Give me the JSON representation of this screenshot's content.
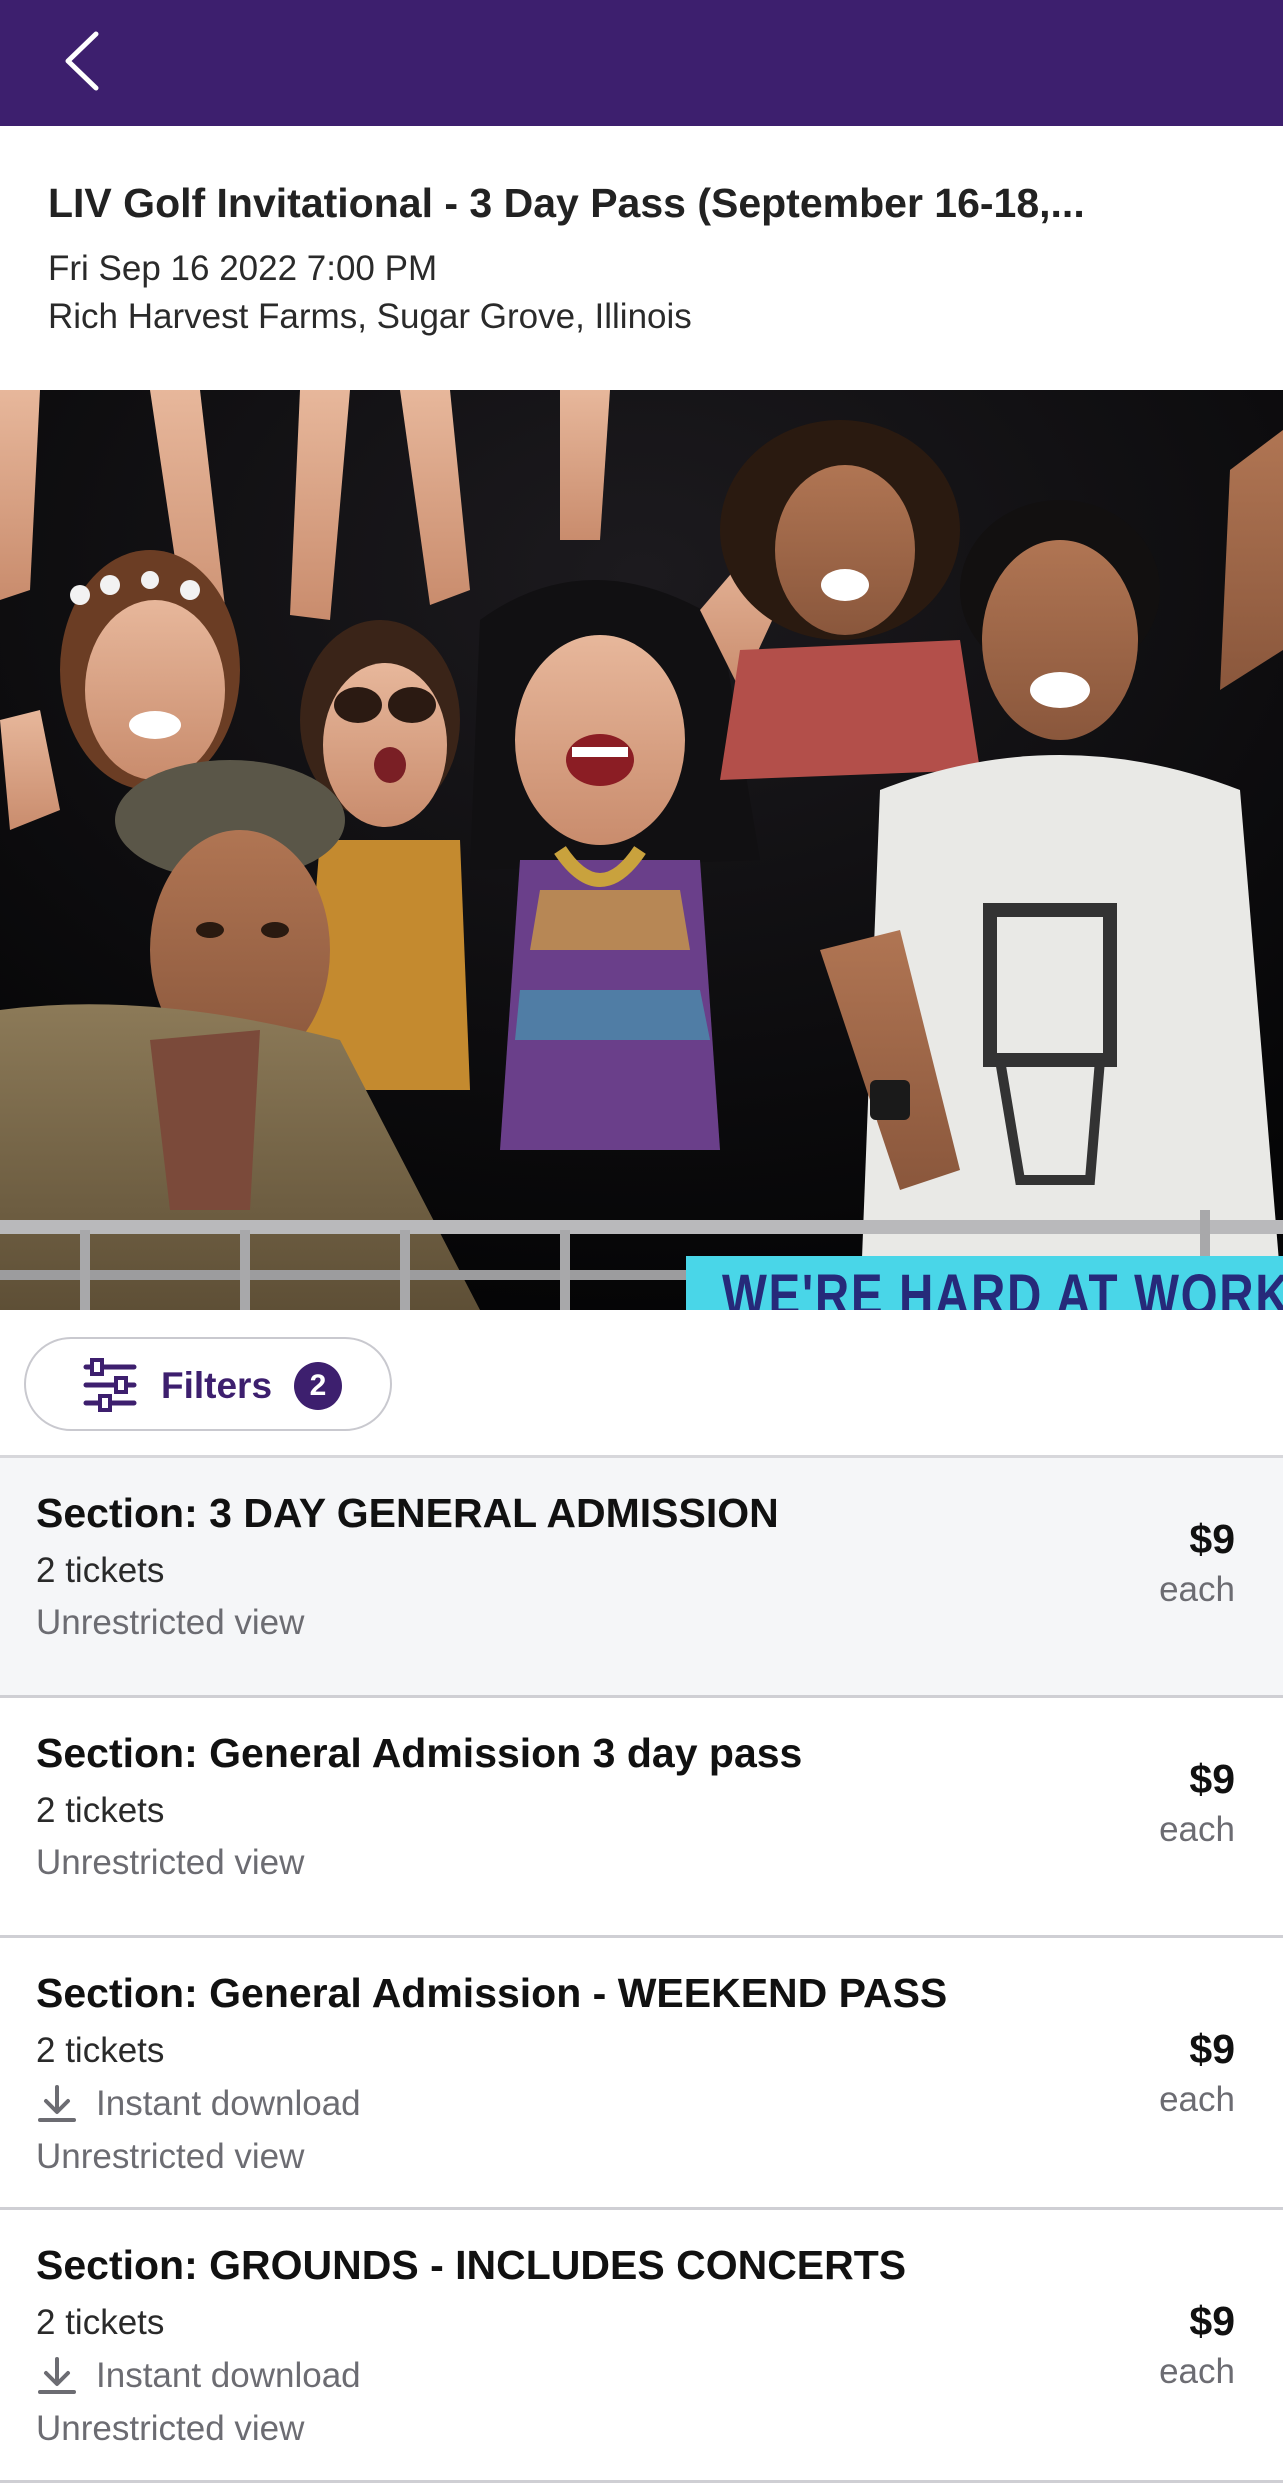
{
  "header": {
    "back_icon": "chevron-left-icon",
    "bar_color": "#3d1f6e"
  },
  "event": {
    "title": "LIV Golf Invitational - 3 Day Pass (September 16-18,...",
    "date": "Fri Sep 16 2022 7:00 PM",
    "venue": "Rich Harvest Farms, Sugar Grove, Illinois"
  },
  "hero": {
    "description_icon": "crowd-photo",
    "banner_text": "WE'RE HARD AT WORK PUTTI"
  },
  "filters": {
    "label": "Filters",
    "count": "2",
    "icon": "sliders-icon"
  },
  "listings": [
    {
      "section": "Section: 3 DAY GENERAL ADMISSION",
      "quantity": "2 tickets",
      "feature": "",
      "view": "Unrestricted view",
      "price": "$9",
      "price_unit": "each"
    },
    {
      "section": "Section: General Admission 3 day pass",
      "quantity": "2 tickets",
      "feature": "",
      "view": "Unrestricted view",
      "price": "$9",
      "price_unit": "each"
    },
    {
      "section": "Section: General Admission - WEEKEND PASS",
      "quantity": "2 tickets",
      "feature": "Instant download",
      "view": "Unrestricted view",
      "price": "$9",
      "price_unit": "each"
    },
    {
      "section": "Section: GROUNDS - INCLUDES CONCERTS",
      "quantity": "2 tickets",
      "feature": "Instant download",
      "view": "Unrestricted view",
      "price": "$9",
      "price_unit": "each"
    }
  ],
  "colors": {
    "brand_purple": "#3d1f6e",
    "highlight_row": "#f5f6f8",
    "muted_text": "#6c6c72"
  }
}
